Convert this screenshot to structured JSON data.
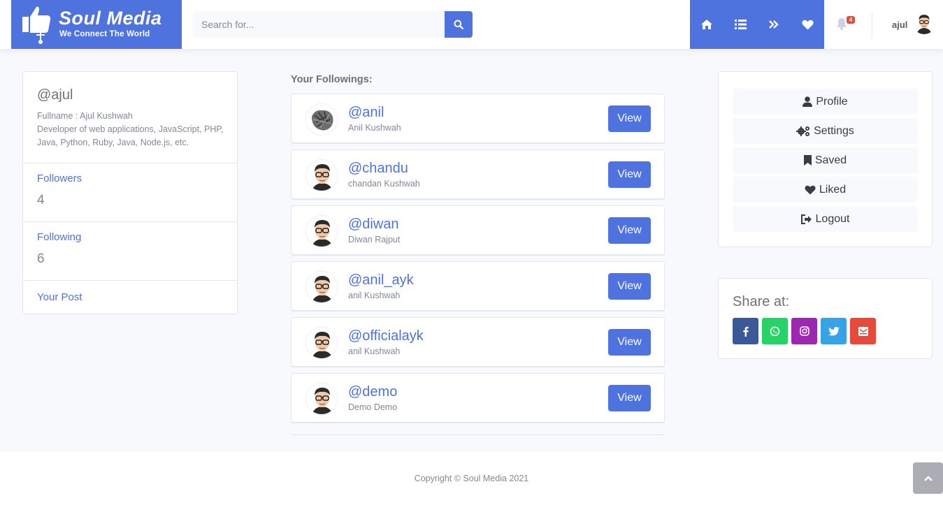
{
  "brand": {
    "name": "Soul Media",
    "tagline": "We Connect The World",
    "color": "#4e73df"
  },
  "search": {
    "placeholder": "Search for...",
    "value": ""
  },
  "nav": {
    "icons": [
      "home-icon",
      "list-icon",
      "double-chevron-right-icon",
      "heart-icon"
    ]
  },
  "notifications": {
    "count": "4"
  },
  "user": {
    "name": "ajul"
  },
  "profile": {
    "handle": "@ajul",
    "fullname": "Fullname : Ajul Kushwah",
    "bio": "Developer of web applications, JavaScript, PHP, Java, Python, Ruby, Java, Node.js, etc.",
    "followers_label": "Followers",
    "followers_count": "4",
    "following_label": "Following",
    "following_count": "6",
    "posts_label": "Your Post"
  },
  "followings": {
    "title": "Your Followings:",
    "view_label": "View",
    "items": [
      {
        "handle": "@anil",
        "name": "Anil Kushwah",
        "avatar": "sketch-avatar"
      },
      {
        "handle": "@chandu",
        "name": "chandan Kushwah",
        "avatar": "cartoon-avatar"
      },
      {
        "handle": "@diwan",
        "name": "Diwan Rajput",
        "avatar": "cartoon-avatar"
      },
      {
        "handle": "@anil_ayk",
        "name": "anil Kushwah",
        "avatar": "cartoon-avatar"
      },
      {
        "handle": "@officialayk",
        "name": "anil Kushwah",
        "avatar": "cartoon-avatar"
      },
      {
        "handle": "@demo",
        "name": "Demo Demo",
        "avatar": "cartoon-avatar"
      }
    ]
  },
  "menu": {
    "items": [
      {
        "label": "Profile",
        "icon": "user-icon"
      },
      {
        "label": "Settings",
        "icon": "cogs-icon"
      },
      {
        "label": "Saved",
        "icon": "bookmark-icon"
      },
      {
        "label": "Liked",
        "icon": "heart-icon"
      },
      {
        "label": "Logout",
        "icon": "sign-out-icon"
      }
    ]
  },
  "share": {
    "title": "Share at:",
    "buttons": [
      {
        "name": "facebook",
        "color": "#3b5998"
      },
      {
        "name": "whatsapp",
        "color": "#25d366"
      },
      {
        "name": "instagram",
        "color": "#9c27b0"
      },
      {
        "name": "twitter",
        "color": "#36a3e8"
      },
      {
        "name": "email",
        "color": "#e74a3b"
      }
    ]
  },
  "footer": {
    "copyright": "Copyright © Soul Media 2021"
  }
}
